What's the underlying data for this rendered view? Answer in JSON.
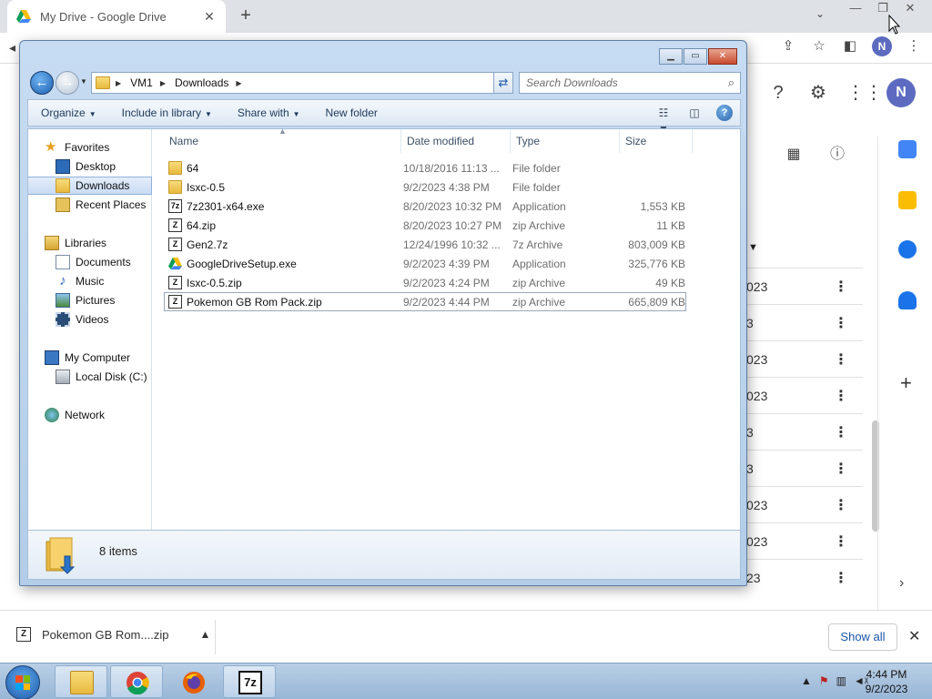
{
  "browser": {
    "tab_title": "My Drive - Google Drive",
    "tab_close": "✕",
    "new_tab": "+",
    "tab_search": "⌄",
    "win_min": "—",
    "win_restore": "❐",
    "win_close": "✕",
    "profile_initial": "N"
  },
  "drive": {
    "avatar_initial": "N",
    "row_fragments": [
      "023",
      "3",
      "023",
      "023",
      "3",
      "3",
      "023",
      "023",
      "23"
    ],
    "row_menu": "⋮",
    "side_plus": "+",
    "chevron": "›"
  },
  "explorer": {
    "caption": {
      "min": "▁",
      "max": "▭",
      "close": "✕"
    },
    "breadcrumb": [
      "VM1",
      "Downloads"
    ],
    "search_placeholder": "Search Downloads",
    "commands": {
      "organize": "Organize",
      "include_in_library": "Include in library",
      "share_with": "Share with",
      "new_folder": "New folder"
    },
    "nav": {
      "favorites": "Favorites",
      "desktop": "Desktop",
      "downloads": "Downloads",
      "recent_places": "Recent Places",
      "libraries": "Libraries",
      "documents": "Documents",
      "music": "Music",
      "pictures": "Pictures",
      "videos": "Videos",
      "my_computer": "My Computer",
      "local_disk": "Local Disk (C:)",
      "network": "Network"
    },
    "columns": {
      "name": "Name",
      "date": "Date modified",
      "type": "Type",
      "size": "Size"
    },
    "files": [
      {
        "name": "64",
        "date": "10/18/2016 11:13 ...",
        "type": "File folder",
        "size": "",
        "icon": "folder-icon"
      },
      {
        "name": "Isxc-0.5",
        "date": "9/2/2023 4:38 PM",
        "type": "File folder",
        "size": "",
        "icon": "folder-icon"
      },
      {
        "name": "7z2301-x64.exe",
        "date": "8/20/2023 10:32 PM",
        "type": "Application",
        "size": "1,553 KB",
        "icon": "7zip-exe-icon"
      },
      {
        "name": "64.zip",
        "date": "8/20/2023 10:27 PM",
        "type": "zip Archive",
        "size": "11 KB",
        "icon": "zip-icon"
      },
      {
        "name": "Gen2.7z",
        "date": "12/24/1996 10:32 ...",
        "type": "7z Archive",
        "size": "803,009 KB",
        "icon": "zip-icon"
      },
      {
        "name": "GoogleDriveSetup.exe",
        "date": "9/2/2023 4:39 PM",
        "type": "Application",
        "size": "325,776 KB",
        "icon": "google-drive-icon"
      },
      {
        "name": "Isxc-0.5.zip",
        "date": "9/2/2023 4:24 PM",
        "type": "zip Archive",
        "size": "49 KB",
        "icon": "zip-icon"
      },
      {
        "name": "Pokemon GB Rom Pack.zip",
        "date": "9/2/2023 4:44 PM",
        "type": "zip Archive",
        "size": "665,809 KB",
        "icon": "zip-icon"
      }
    ],
    "item_count": "8 items"
  },
  "download_bar": {
    "file_name": "Pokemon GB Rom....zip",
    "show_all": "Show all",
    "close": "✕"
  },
  "taskbar": {
    "time": "4:44 PM",
    "date": "9/2/2023",
    "apps": [
      "windows-explorer",
      "google-chrome",
      "firefox",
      "7-zip"
    ]
  },
  "colors": {
    "chrome_tabbar": "#dee1e6",
    "win7_glass": "#b3cde8",
    "accent_blue": "#1d5aa8",
    "avatar": "#5c6bc0"
  }
}
